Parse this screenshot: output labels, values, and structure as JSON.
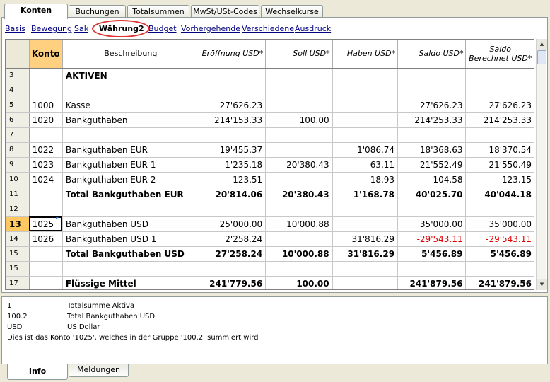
{
  "top_tabs": [
    "Konten",
    "Buchungen",
    "Totalsummen",
    "MwSt/USt-Codes",
    "Wechselkurse"
  ],
  "views": [
    "Basis",
    "Bewegung",
    "Saldo",
    "Währung2",
    "Budget",
    "Vorhergehende",
    "Verschiedene",
    "Ausdruck"
  ],
  "columns": [
    "",
    "Konto",
    "Beschreibung",
    "Eröffnung USD*",
    "Soll USD*",
    "Haben USD*",
    "Saldo USD*",
    "Saldo Berechnet USD*"
  ],
  "rows": [
    {
      "n": "3",
      "konto": "",
      "desc": "AKTIVEN",
      "op": "",
      "soll": "",
      "haben": "",
      "saldo": "",
      "saldo_b": "",
      "bold": true
    },
    {
      "n": "4",
      "konto": "",
      "desc": "",
      "op": "",
      "soll": "",
      "haben": "",
      "saldo": "",
      "saldo_b": ""
    },
    {
      "n": "5",
      "konto": "1000",
      "desc": "Kasse",
      "op": "27'626.23",
      "soll": "",
      "haben": "",
      "saldo": "27'626.23",
      "saldo_b": "27'626.23"
    },
    {
      "n": "6",
      "konto": "1020",
      "desc": "Bankguthaben",
      "op": "214'153.33",
      "soll": "100.00",
      "haben": "",
      "saldo": "214'253.33",
      "saldo_b": "214'253.33"
    },
    {
      "n": "7",
      "konto": "",
      "desc": "",
      "op": "",
      "soll": "",
      "haben": "",
      "saldo": "",
      "saldo_b": ""
    },
    {
      "n": "8",
      "konto": "1022",
      "desc": "Bankguthaben EUR",
      "op": "19'455.37",
      "soll": "",
      "haben": "1'086.74",
      "saldo": "18'368.63",
      "saldo_b": "18'370.54"
    },
    {
      "n": "9",
      "konto": "1023",
      "desc": "Bankguthaben EUR 1",
      "op": "1'235.18",
      "soll": "20'380.43",
      "haben": "63.11",
      "saldo": "21'552.49",
      "saldo_b": "21'550.49"
    },
    {
      "n": "10",
      "konto": "1024",
      "desc": "Bankguthaben EUR 2",
      "op": "123.51",
      "soll": "",
      "haben": "18.93",
      "saldo": "104.58",
      "saldo_b": "123.15"
    },
    {
      "n": "11",
      "konto": "",
      "desc": "Total Bankguthaben EUR",
      "op": "20'814.06",
      "soll": "20'380.43",
      "haben": "1'168.78",
      "saldo": "40'025.70",
      "saldo_b": "40'044.18",
      "bold": true
    },
    {
      "n": "12",
      "konto": "",
      "desc": "",
      "op": "",
      "soll": "",
      "haben": "",
      "saldo": "",
      "saldo_b": ""
    },
    {
      "n": "13",
      "konto": "1025",
      "desc": "Bankguthaben USD",
      "op": "25'000.00",
      "soll": "10'000.88",
      "haben": "",
      "saldo": "35'000.00",
      "saldo_b": "35'000.00",
      "current": true
    },
    {
      "n": "14",
      "konto": "1026",
      "desc": "Bankguthaben USD 1",
      "op": "2'258.24",
      "soll": "",
      "haben": "31'816.29",
      "saldo": "-29'543.11",
      "saldo_b": "-29'543.11",
      "neg": true
    },
    {
      "n": "15",
      "konto": "",
      "desc": "Total Bankguthaben USD",
      "op": "27'258.24",
      "soll": "10'000.88",
      "haben": "31'816.29",
      "saldo": "5'456.89",
      "saldo_b": "5'456.89",
      "bold": true
    },
    {
      "n": "15",
      "konto": "",
      "desc": "",
      "op": "",
      "soll": "",
      "haben": "",
      "saldo": "",
      "saldo_b": ""
    },
    {
      "n": "17",
      "konto": "",
      "desc": "Flüssige Mittel",
      "op": "241'779.56",
      "soll": "100.00",
      "haben": "",
      "saldo": "241'879.56",
      "saldo_b": "241'879.56",
      "bold": true
    }
  ],
  "info_lines": [
    {
      "left": "1",
      "right": "Totalsumme Aktiva"
    },
    {
      "left": "100.2",
      "right": "Total Bankguthaben USD"
    },
    {
      "left": "USD",
      "right": "US Dollar"
    },
    {
      "left": "Dies ist das Konto '1025', welches in der Gruppe '100.2' summiert wird",
      "right": ""
    }
  ],
  "bottom_tabs": [
    "Info",
    "Meldungen"
  ],
  "colors": {
    "current_row": "#ffc860",
    "negative": "#e00000",
    "highlight_circle": "#e03030"
  }
}
